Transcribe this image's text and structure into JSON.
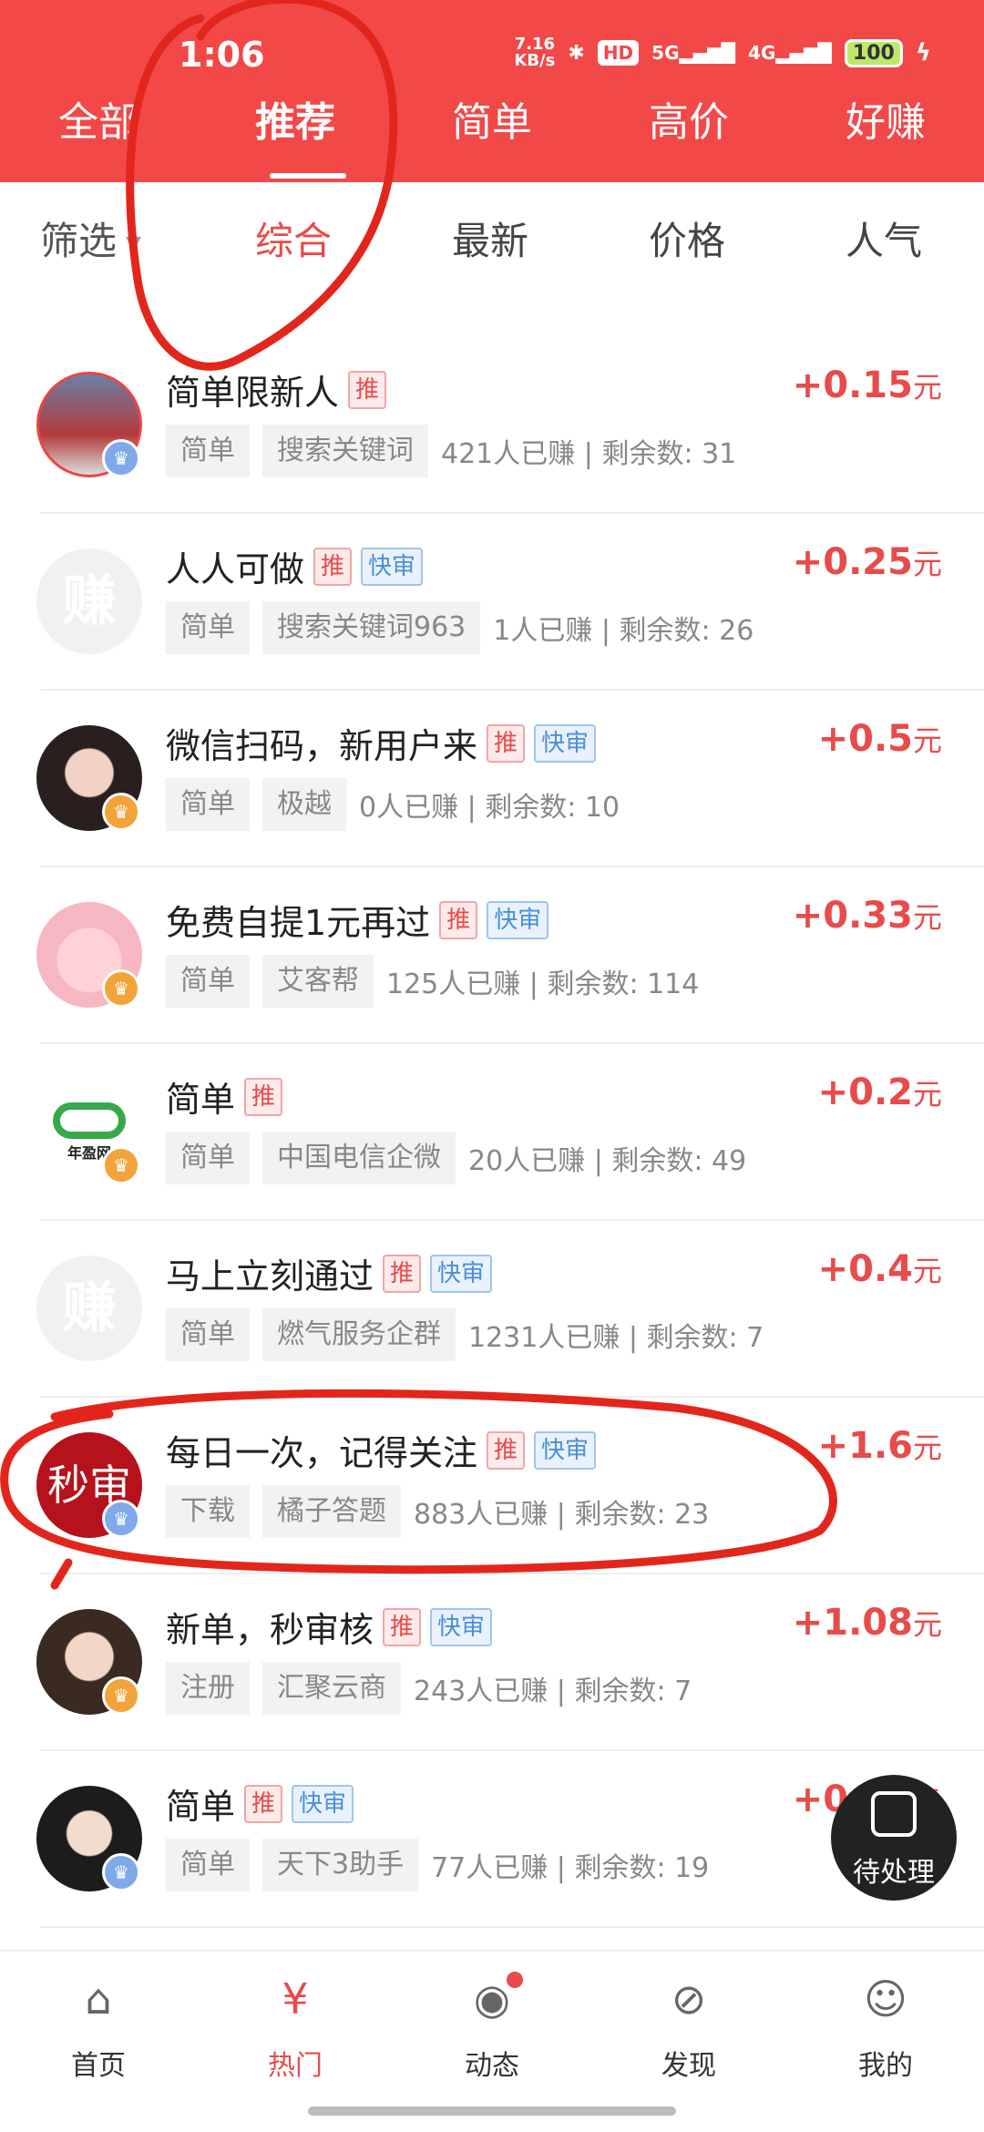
{
  "status": {
    "time": "1:06",
    "netspeed": "7.16\nKB/s",
    "hd": "HD",
    "sig1": "5G",
    "sig2": "4G",
    "battery": "100"
  },
  "top_tabs": [
    "全部",
    "推荐",
    "简单",
    "高价",
    "好赚"
  ],
  "filter": {
    "label": "筛选",
    "tabs": [
      "综合",
      "最新",
      "价格",
      "人气"
    ]
  },
  "tasks": [
    {
      "title": "简单限新人",
      "tags": [
        "推"
      ],
      "amount": "+0.15",
      "unit": "元",
      "chips": [
        "简单",
        "搜索关键词"
      ],
      "meta": "421人已赚 | 剩余数: 31"
    },
    {
      "title": "人人可做",
      "tags": [
        "推",
        "快审"
      ],
      "amount": "+0.25",
      "unit": "元",
      "chips": [
        "简单",
        "搜索关键词963"
      ],
      "meta": "1人已赚 | 剩余数: 26",
      "avatar_text": "赚"
    },
    {
      "title": "微信扫码，新用户来",
      "tags": [
        "推",
        "快审"
      ],
      "amount": "+0.5",
      "unit": "元",
      "chips": [
        "简单",
        "极越"
      ],
      "meta": "0人已赚 | 剩余数: 10"
    },
    {
      "title": "免费自提1元再过",
      "tags": [
        "推",
        "快审"
      ],
      "amount": "+0.33",
      "unit": "元",
      "chips": [
        "简单",
        "艾客帮"
      ],
      "meta": "125人已赚 | 剩余数: 114"
    },
    {
      "title": "简单",
      "tags": [
        "推"
      ],
      "amount": "+0.2",
      "unit": "元",
      "chips": [
        "简单",
        "中国电信企微"
      ],
      "meta": "20人已赚 | 剩余数: 49",
      "logo_text": "年盈网"
    },
    {
      "title": "马上立刻通过",
      "tags": [
        "推",
        "快审"
      ],
      "amount": "+0.4",
      "unit": "元",
      "chips": [
        "简单",
        "燃气服务企群"
      ],
      "meta": "1231人已赚 | 剩余数: 7",
      "avatar_text": "赚"
    },
    {
      "title": "每日一次，记得关注",
      "tags": [
        "推",
        "快审"
      ],
      "amount": "+1.6",
      "unit": "元",
      "chips": [
        "下载",
        "橘子答题"
      ],
      "meta": "883人已赚 | 剩余数: 23",
      "avatar_text": "秒审"
    },
    {
      "title": "新单，秒审核",
      "tags": [
        "推",
        "快审"
      ],
      "amount": "+1.08",
      "unit": "元",
      "chips": [
        "注册",
        "汇聚云商"
      ],
      "meta": "243人已赚 | 剩余数: 7"
    },
    {
      "title": "简单",
      "tags": [
        "推",
        "快审"
      ],
      "amount": "+0.52",
      "unit": "元",
      "chips": [
        "简单",
        "天下3助手"
      ],
      "meta": "77人已赚 | 剩余数: 19"
    }
  ],
  "fab": {
    "label": "待处理"
  },
  "tabbar": [
    "首页",
    "热门",
    "动态",
    "发现",
    "我的"
  ],
  "colors": {
    "brand_red": "#f24848",
    "price_red": "#e84b4b",
    "fast_blue": "#4a8fd8"
  }
}
